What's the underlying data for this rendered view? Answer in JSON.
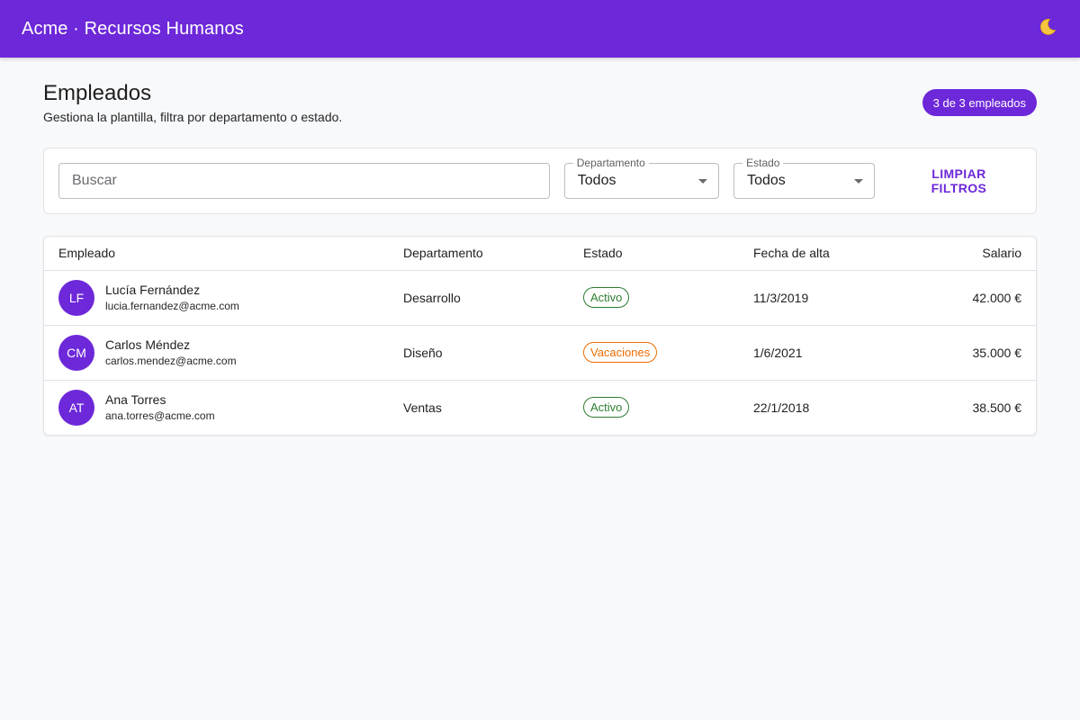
{
  "app": {
    "title": "Acme · Recursos Humanos",
    "theme_toggle_icon": "moon-icon",
    "accent_color": "#6d28d9"
  },
  "page": {
    "title": "Empleados",
    "subtitle": "Gestiona la plantilla, filtra por departamento o estado.",
    "count_label": "3 de 3 empleados"
  },
  "filters": {
    "search_placeholder": "Buscar",
    "search_value": "",
    "department_label": "Departamento",
    "department_value": "Todos",
    "status_label": "Estado",
    "status_value": "Todos",
    "clear_label": "LIMPIAR FILTROS"
  },
  "table": {
    "headers": {
      "employee": "Empleado",
      "department": "Departamento",
      "status": "Estado",
      "hire_date": "Fecha de alta",
      "salary": "Salario"
    },
    "rows": [
      {
        "initials": "LF",
        "name": "Lucía Fernández",
        "email": "lucia.fernandez@acme.com",
        "department": "Desarrollo",
        "status": "Activo",
        "status_color": "#2e7d32",
        "hire_date": "11/3/2019",
        "salary": "42.000 €"
      },
      {
        "initials": "CM",
        "name": "Carlos Méndez",
        "email": "carlos.mendez@acme.com",
        "department": "Diseño",
        "status": "Vacaciones",
        "status_color": "#ed6c02",
        "hire_date": "1/6/2021",
        "salary": "35.000 €"
      },
      {
        "initials": "AT",
        "name": "Ana Torres",
        "email": "ana.torres@acme.com",
        "department": "Ventas",
        "status": "Activo",
        "status_color": "#2e7d32",
        "hire_date": "22/1/2018",
        "salary": "38.500 €"
      }
    ]
  }
}
